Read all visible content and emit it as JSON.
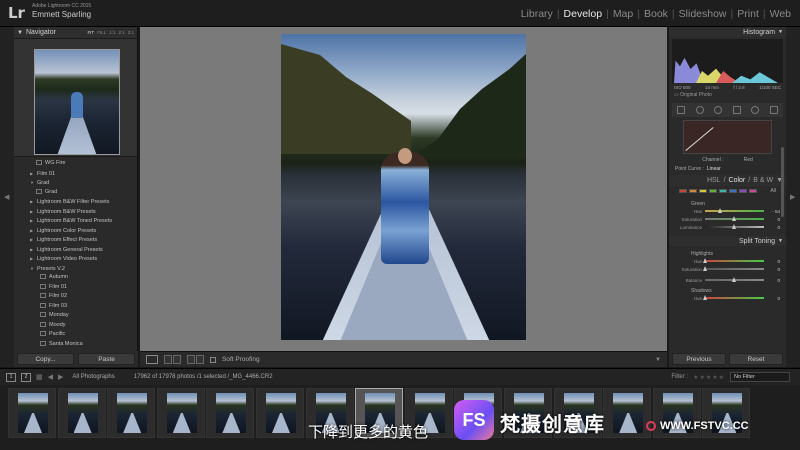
{
  "app": {
    "logo": "Lr",
    "version": "Adobe Lightroom CC 2015",
    "user": "Emmett Sparling"
  },
  "modules": [
    "Library",
    "Develop",
    "Map",
    "Book",
    "Slideshow",
    "Print",
    "Web"
  ],
  "active_module": "Develop",
  "navigator": {
    "title": "Navigator",
    "zooms": [
      "FIT",
      "FILL",
      "1:1",
      "2:1",
      "3:1"
    ],
    "active_zoom": "FIT"
  },
  "presets": [
    {
      "label": "WG Fire",
      "kind": "item"
    },
    {
      "label": "Film 01",
      "kind": "folder-closed"
    },
    {
      "label": "Grad",
      "kind": "folder-open"
    },
    {
      "label": "Grad",
      "kind": "item"
    },
    {
      "label": "Lightroom B&W Filter Presets",
      "kind": "folder-closed"
    },
    {
      "label": "Lightroom B&W Presets",
      "kind": "folder-closed"
    },
    {
      "label": "Lightroom B&W Toned Presets",
      "kind": "folder-closed"
    },
    {
      "label": "Lightroom Color Presets",
      "kind": "folder-closed"
    },
    {
      "label": "Lightroom Effect Presets",
      "kind": "folder-closed"
    },
    {
      "label": "Lightroom General Presets",
      "kind": "folder-closed"
    },
    {
      "label": "Lightroom Video Presets",
      "kind": "folder-closed"
    },
    {
      "label": "Presets V.2",
      "kind": "folder-open"
    },
    {
      "label": "Autumn",
      "kind": "item"
    },
    {
      "label": "Film 01",
      "kind": "item"
    },
    {
      "label": "Film 02",
      "kind": "item"
    },
    {
      "label": "Film 03",
      "kind": "item"
    },
    {
      "label": "Monday",
      "kind": "item"
    },
    {
      "label": "Moody",
      "kind": "item"
    },
    {
      "label": "Pacific",
      "kind": "item"
    },
    {
      "label": "Santa Monica",
      "kind": "item"
    }
  ],
  "left_buttons": {
    "copy": "Copy...",
    "paste": "Paste"
  },
  "toolbar": {
    "soft_proofing": "Soft Proofing"
  },
  "right_panel": {
    "histogram_title": "Histogram",
    "hist_info": [
      "ISO 500",
      "14 mm",
      "f / 2.8",
      "1/100 SEC"
    ],
    "original_photo": "Original Photo",
    "channel_label": "Channel :",
    "channel_value": "Red",
    "point_curve_label": "Point Curve :",
    "point_curve_value": "Linear",
    "hsl_tabs": [
      "HSL",
      "Color",
      "B & W"
    ],
    "hsl_seps": [
      "/",
      "/"
    ],
    "hsl_active": "Color",
    "swatches": [
      "#c4453a",
      "#d8873a",
      "#d9c73a",
      "#5fb33a",
      "#3ab5a8",
      "#3a6fc8",
      "#8a4ac8",
      "#c84a9a"
    ],
    "all_label": "All",
    "green_title": "Green",
    "green_sliders": [
      {
        "label": "Hue",
        "value": "- 54",
        "pos": 0.27,
        "track": "#c8a34a,#4ab34a"
      },
      {
        "label": "Saturation",
        "value": "0",
        "pos": 0.5,
        "track": "#777,#4ab34a"
      },
      {
        "label": "Luminance",
        "value": "0",
        "pos": 0.5,
        "track": "#222,#bbb"
      }
    ],
    "split_toning_title": "Split Toning",
    "highlights_title": "Highlights",
    "highlight_sliders": [
      {
        "label": "Hue",
        "value": "0",
        "pos": 0.0,
        "track": "#c44,#4c4"
      },
      {
        "label": "Saturation",
        "value": "0",
        "pos": 0.0,
        "track": "#555,#888"
      }
    ],
    "balance_slider": {
      "label": "Balance",
      "value": "0",
      "pos": 0.5,
      "track": "#666,#888"
    },
    "shadows_title": "Shadows",
    "shadow_sliders": [
      {
        "label": "Hue",
        "value": "0",
        "pos": 0.0,
        "track": "#c44,#4c4"
      }
    ]
  },
  "right_buttons": {
    "previous": "Previous",
    "reset": "Reset"
  },
  "filmstrip_bar": {
    "view1": "1",
    "view2": "2",
    "source": "All Photographs",
    "count": "17962 of 17978 photos /1 selected /_MG_4466.CR2",
    "filter_label": "Filter :",
    "stars": "★★★★★",
    "filter_value": "No Filter"
  },
  "filmstrip_count": 15,
  "filmstrip_selected": 7,
  "subtitle": "下降到更多的黄色",
  "watermark": {
    "logo": "FS",
    "name": "梵摄创意库",
    "url": "WWW.FSTVC.CC"
  }
}
